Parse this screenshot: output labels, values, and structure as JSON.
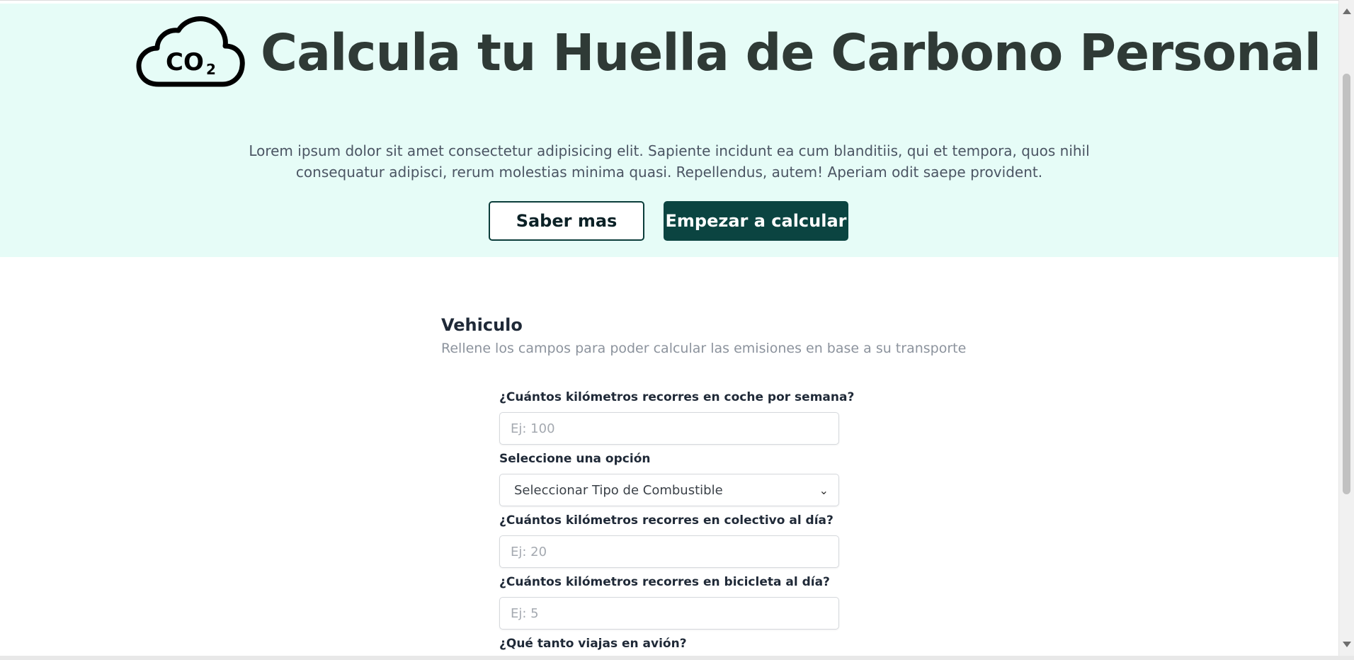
{
  "hero": {
    "logo_icon": "co2-cloud-icon",
    "logo_text": "CO₂",
    "title": "Calcula tu Huella de Carbono Personal",
    "description": "Lorem ipsum dolor sit amet consectetur adipisicing elit. Sapiente incidunt ea cum blanditiis, qui et tempora, quos nihil consequatur adipisci, rerum molestias minima quasi. Repellendus, autem! Aperiam odit saepe provident.",
    "learn_more_label": "Saber mas",
    "start_label": "Empezar a calcular",
    "background_color": "#e6fcf7",
    "accent_color": "#0b4441"
  },
  "vehicle": {
    "title": "Vehiculo",
    "subtitle": "Rellene los campos para poder calcular las emisiones en base a su transporte",
    "car_km_label": "¿Cuántos kilómetros recorres en coche por semana?",
    "car_km_placeholder": "Ej: 100",
    "fuel_label": "Seleccione una opción",
    "fuel_selected": "Seleccionar Tipo de Combustible",
    "bus_km_label": "¿Cuántos kilómetros recorres en colectivo al día?",
    "bus_km_placeholder": "Ej: 20",
    "bike_km_label": "¿Cuántos kilómetros recorres en bicicleta al día?",
    "bike_km_placeholder": "Ej: 5",
    "plane_label": "¿Qué tanto viajas en avión?"
  }
}
